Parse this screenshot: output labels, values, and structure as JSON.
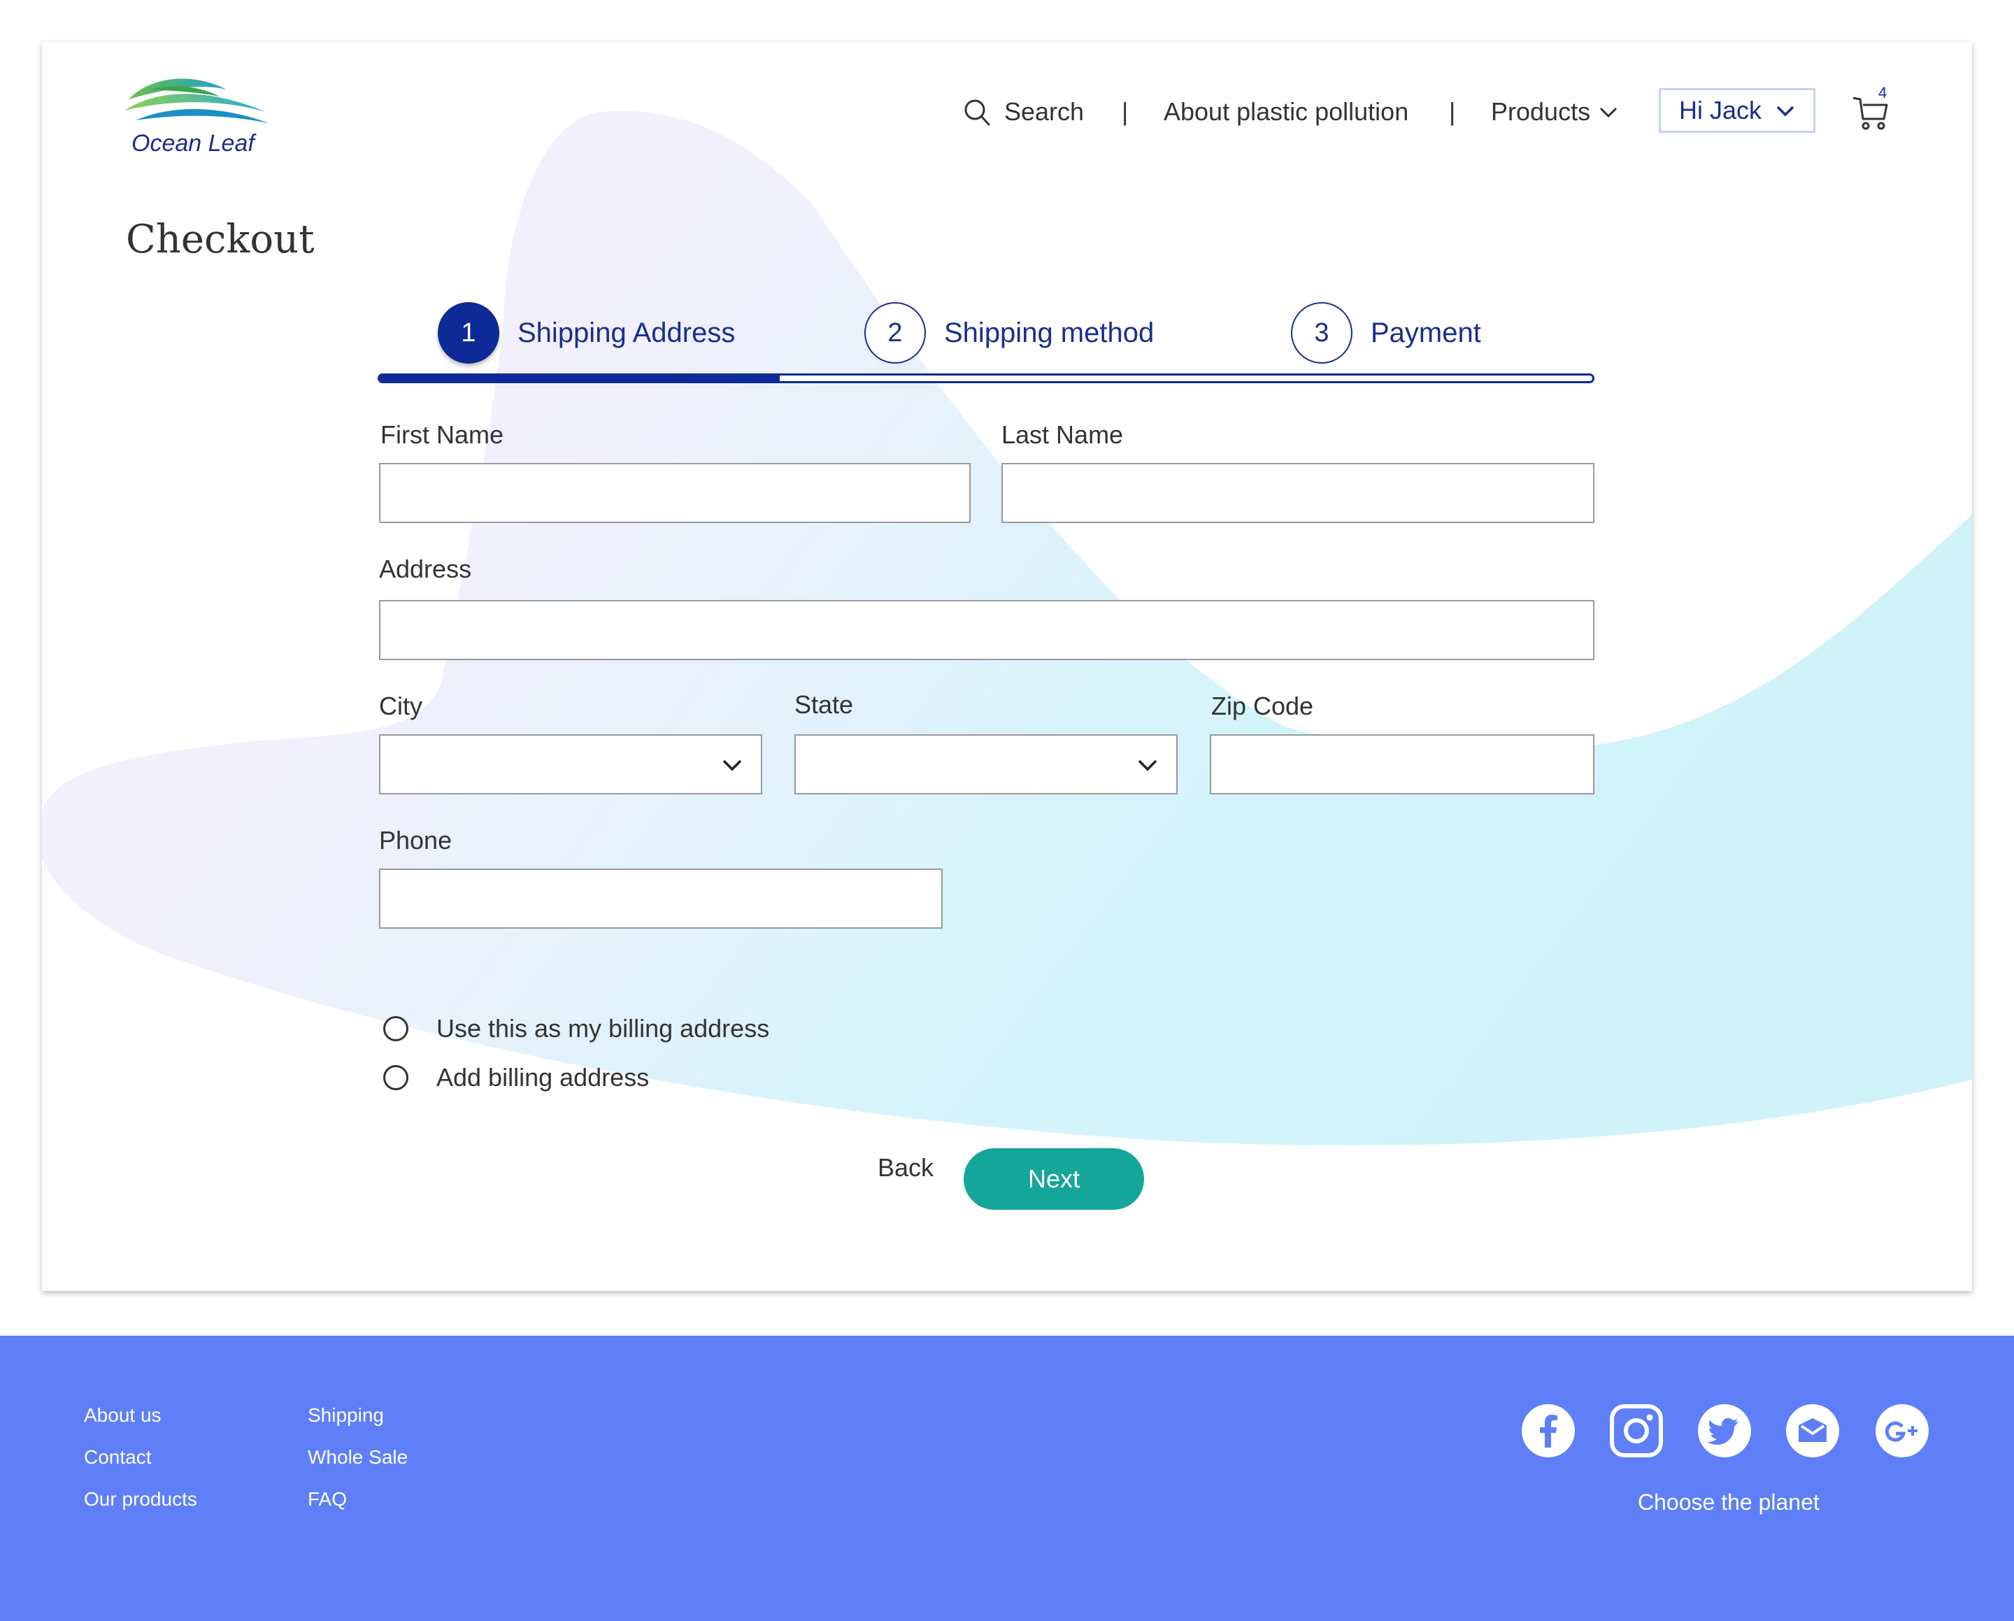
{
  "brand": {
    "name": "Ocean Leaf"
  },
  "header": {
    "search_label": "Search",
    "separator": "|",
    "about_label": "About plastic pollution",
    "products_label": "Products",
    "user_label": "Hi Jack",
    "cart_count": "4"
  },
  "page": {
    "title": "Checkout"
  },
  "stepper": {
    "progress": 0.33,
    "steps": [
      {
        "number": "1",
        "label": "Shipping Address",
        "state": "active"
      },
      {
        "number": "2",
        "label": "Shipping method",
        "state": "pending"
      },
      {
        "number": "3",
        "label": "Payment",
        "state": "pending"
      }
    ]
  },
  "form": {
    "first_name": {
      "label": "First Name",
      "value": ""
    },
    "last_name": {
      "label": "Last Name",
      "value": ""
    },
    "address": {
      "label": "Address",
      "value": ""
    },
    "city": {
      "label": "City",
      "value": ""
    },
    "state": {
      "label": "State",
      "value": ""
    },
    "zip": {
      "label": "Zip Code",
      "value": ""
    },
    "phone": {
      "label": "Phone",
      "value": ""
    },
    "billing_options": [
      {
        "label": "Use this as my billing address",
        "selected": false
      },
      {
        "label": "Add billing address",
        "selected": false
      }
    ]
  },
  "actions": {
    "back_label": "Back",
    "next_label": "Next"
  },
  "footer": {
    "col1": [
      "About us",
      "Contact",
      "Our products"
    ],
    "col2": [
      "Shipping",
      "Whole Sale",
      "FAQ"
    ],
    "social_icons": [
      "facebook-icon",
      "instagram-icon",
      "twitter-icon",
      "mail-icon",
      "google-plus-icon"
    ],
    "tagline": "Choose the planet"
  },
  "colors": {
    "brand_navy": "#0e2a96",
    "accent_teal": "#14a69a",
    "footer_blue": "#5e7ff8"
  }
}
